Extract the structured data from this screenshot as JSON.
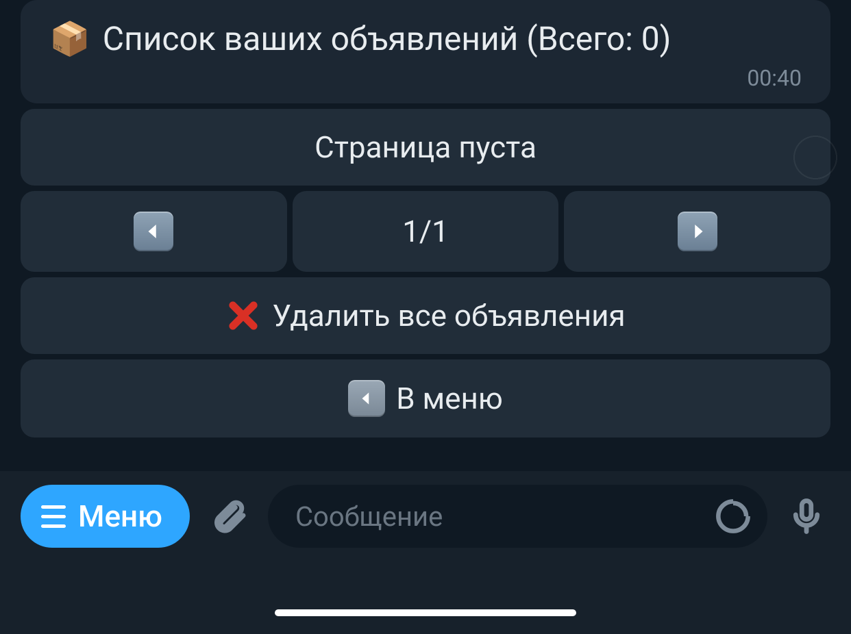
{
  "message": {
    "icon": "package-emoji",
    "text": "Список ваших объявлений (Всего: 0)",
    "time": "00:40"
  },
  "keyboard": {
    "empty_page": "Страница пуста",
    "page_indicator": "1/1",
    "delete_all": "Удалить все объявления",
    "to_menu": "В меню"
  },
  "input_bar": {
    "menu_label": "Меню",
    "placeholder": "Сообщение"
  }
}
